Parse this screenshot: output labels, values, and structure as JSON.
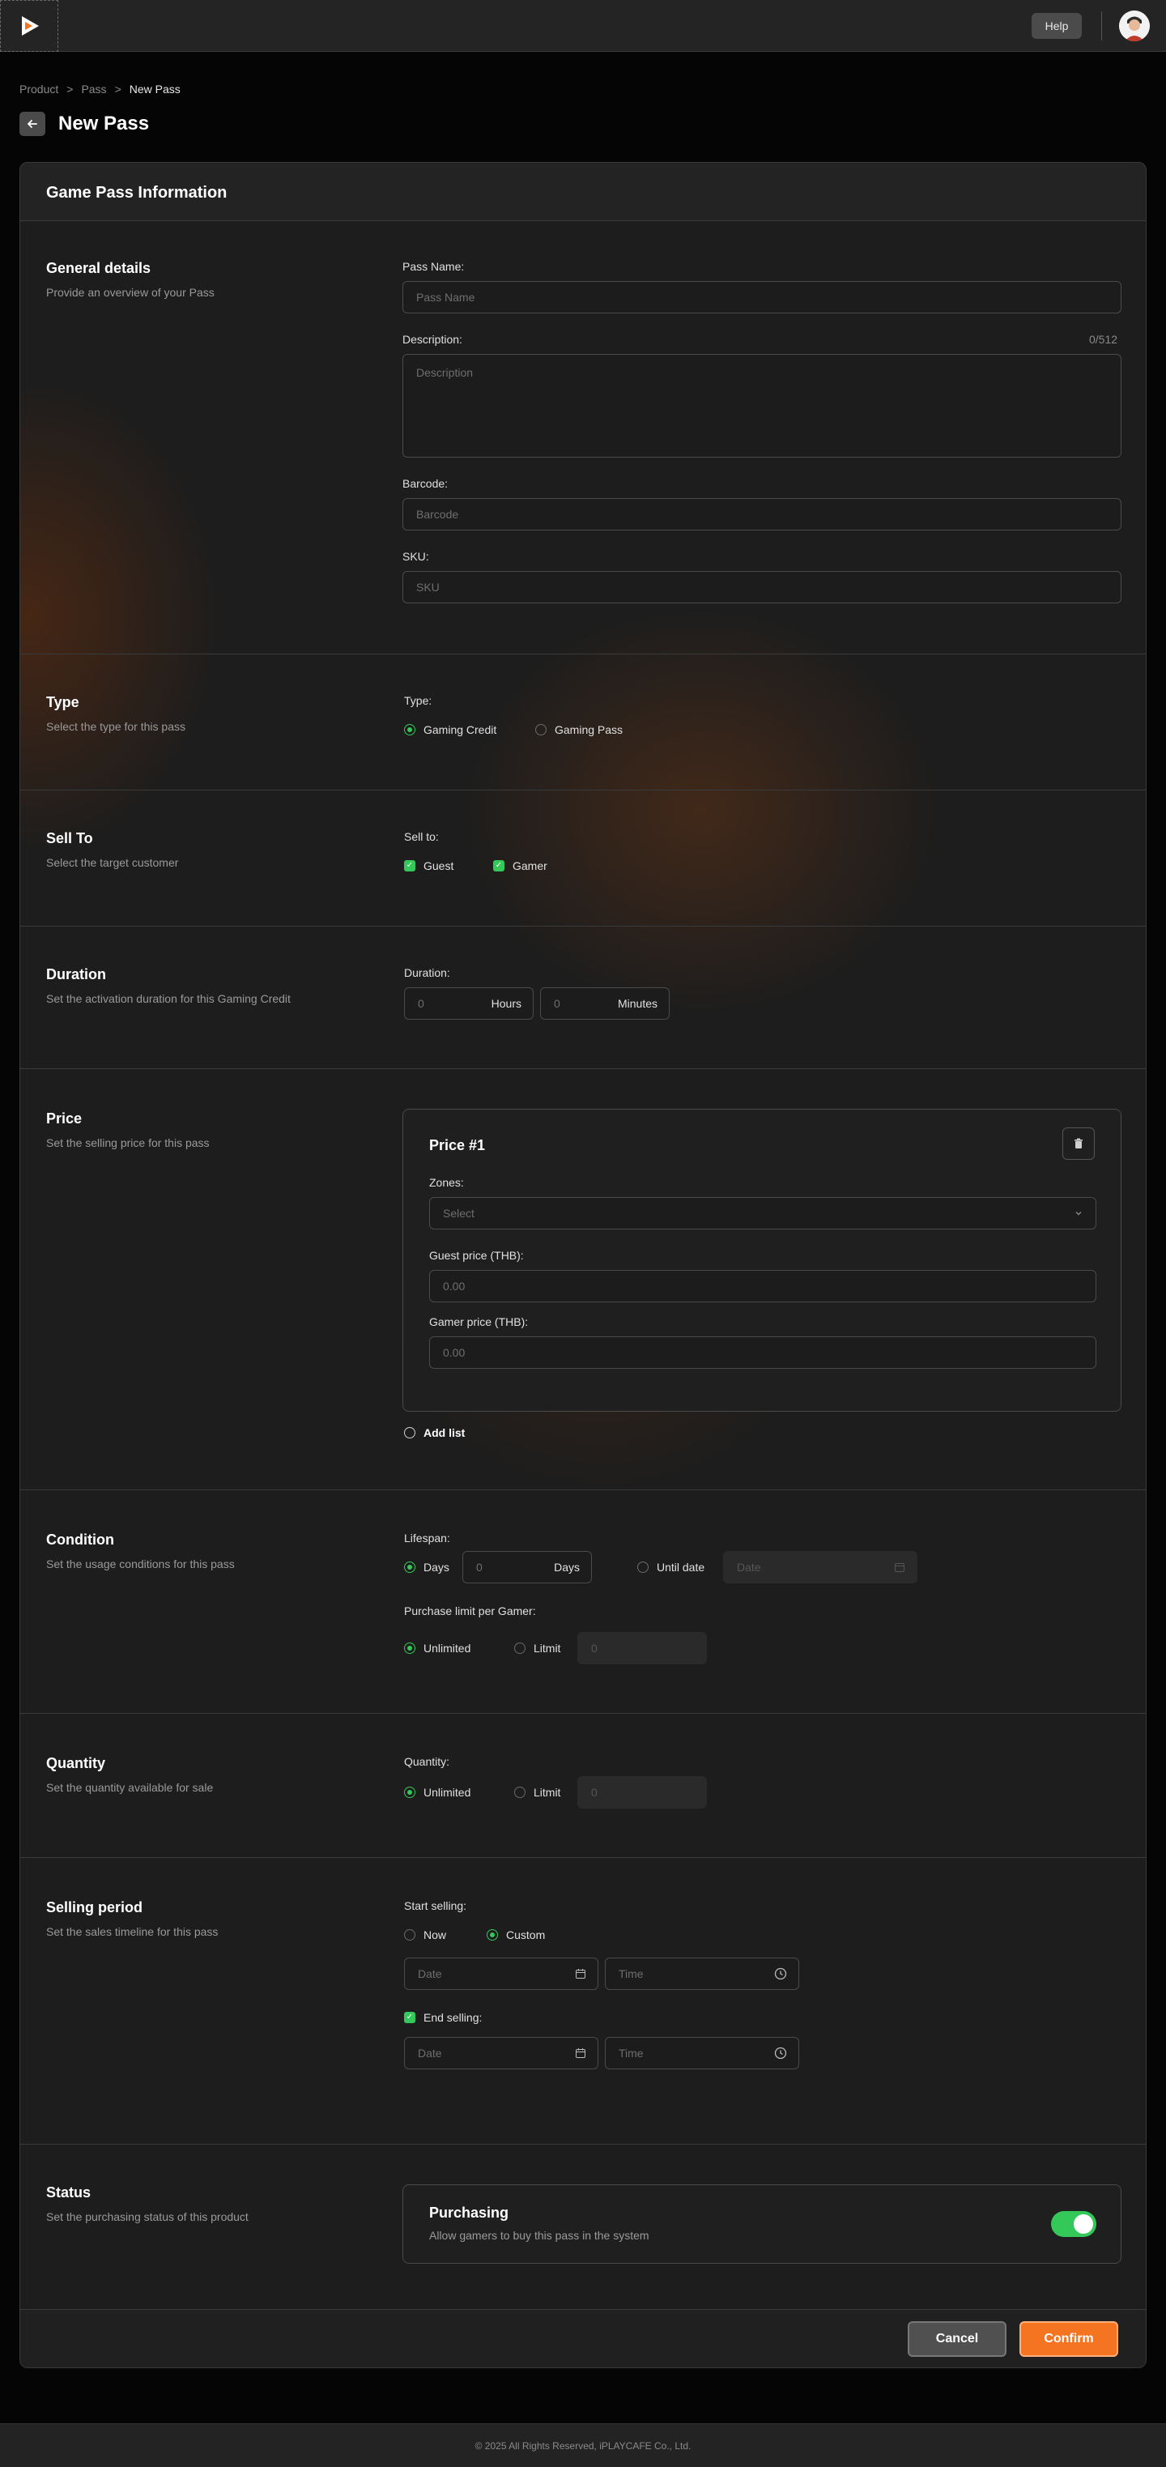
{
  "header": {
    "help_label": "Help"
  },
  "breadcrumb": {
    "items": [
      "Product",
      "Pass",
      "New Pass"
    ],
    "separator": ">"
  },
  "page": {
    "title": "New Pass"
  },
  "card": {
    "title": "Game Pass Information"
  },
  "general": {
    "title": "General details",
    "subtitle": "Provide an overview of your Pass",
    "pass_name_label": "Pass Name:",
    "pass_name_placeholder": "Pass Name",
    "description_label": "Description:",
    "description_counter": "0/512",
    "description_placeholder": "Description",
    "barcode_label": "Barcode:",
    "barcode_placeholder": "Barcode",
    "sku_label": "SKU:",
    "sku_placeholder": "SKU"
  },
  "type": {
    "title": "Type",
    "subtitle": "Select the type for this pass",
    "label": "Type:",
    "options": [
      "Gaming Credit",
      "Gaming Pass"
    ],
    "selected": "Gaming Credit"
  },
  "sell_to": {
    "title": "Sell To",
    "subtitle": "Select the target customer",
    "label": "Sell to:",
    "options": [
      "Guest",
      "Gamer"
    ],
    "checked": [
      "Guest",
      "Gamer"
    ]
  },
  "duration": {
    "title": "Duration",
    "subtitle": "Set the activation duration for this Gaming Credit",
    "label": "Duration:",
    "hours_value": "0",
    "hours_unit": "Hours",
    "minutes_value": "0",
    "minutes_unit": "Minutes"
  },
  "price": {
    "title": "Price",
    "subtitle": "Set the selling price for this pass",
    "item_title": "Price #1",
    "zones_label": "Zones:",
    "zones_placeholder": "Select",
    "guest_label": "Guest price (THB):",
    "guest_placeholder": "0.00",
    "gamer_label": "Gamer price (THB):",
    "gamer_placeholder": "0.00",
    "add_list_label": "Add list"
  },
  "condition": {
    "title": "Condition",
    "subtitle": "Set the usage conditions for this pass",
    "lifespan_label": "Lifespan:",
    "days_option": "Days",
    "days_value": "0",
    "days_unit": "Days",
    "until_option": "Until date",
    "until_placeholder": "Date",
    "limit_label": "Purchase limit per Gamer:",
    "unlimited_option": "Unlimited",
    "limit_option": "Litmit",
    "limit_placeholder": "0"
  },
  "quantity": {
    "title": "Quantity",
    "subtitle": "Set the quantity available for sale",
    "label": "Quantity:",
    "unlimited_option": "Unlimited",
    "limit_option": "Litmit",
    "limit_placeholder": "0"
  },
  "selling_period": {
    "title": "Selling period",
    "subtitle": "Set the sales timeline for this pass",
    "start_label": "Start selling:",
    "now_option": "Now",
    "custom_option": "Custom",
    "start_date_placeholder": "Date",
    "start_time_placeholder": "Time",
    "end_label": "End selling:",
    "end_date_placeholder": "Date",
    "end_time_placeholder": "Time"
  },
  "status": {
    "title": "Status",
    "subtitle": "Set the purchasing status of this product",
    "box_title": "Purchasing",
    "box_desc": "Allow gamers to buy this pass in the system",
    "toggle_on": true
  },
  "actions": {
    "cancel": "Cancel",
    "confirm": "Confirm"
  },
  "footer": {
    "text": "© 2025 All Rights Reserved, iPLAYCAFE Co., Ltd."
  },
  "colors": {
    "accent": "#f47421",
    "success": "#34c759",
    "background": "#050505"
  },
  "icons": [
    "logo-play-icon",
    "avatar-icon",
    "arrow-left-icon",
    "trash-icon",
    "chevron-down-icon",
    "calendar-icon",
    "clock-icon",
    "check-icon"
  ]
}
